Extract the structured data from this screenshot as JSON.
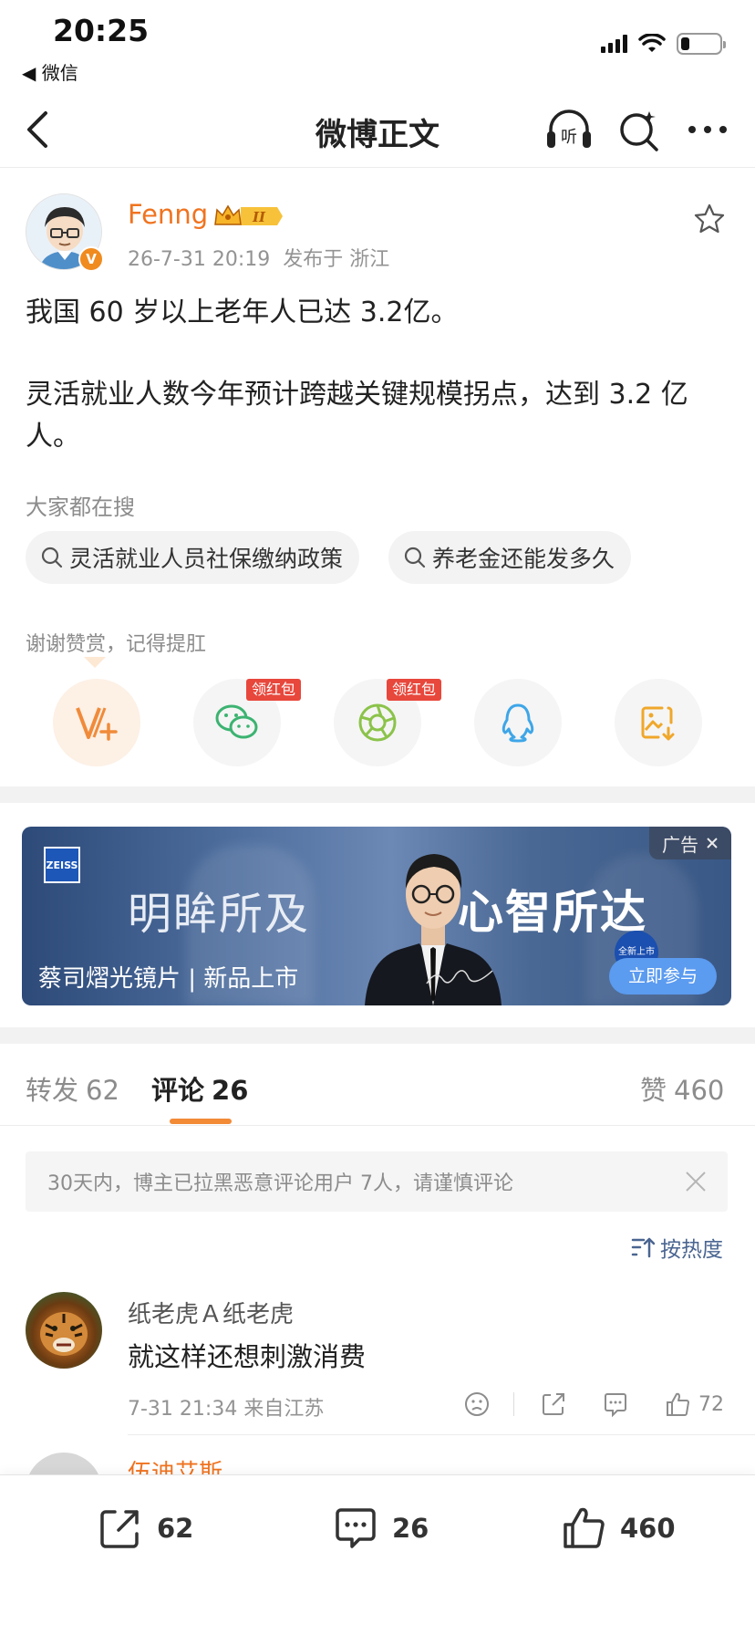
{
  "status_bar": {
    "time": "20:25",
    "back_app": "◀ 微信"
  },
  "nav": {
    "title": "微博正文",
    "listen_label": "听"
  },
  "post": {
    "author": "Fenng",
    "level_badge": "II",
    "date": "26-7-31 20:19",
    "location": "发布于 浙江",
    "paragraphs": [
      "我国 60 岁以上老年人已达 3.2亿。",
      "灵活就业人数今年预计跨越关键规模拐点，达到 3.2 亿人。"
    ]
  },
  "search_section": {
    "title": "大家都在搜",
    "chips": [
      "灵活就业人员社保缴纳政策",
      "养老金还能发多久"
    ]
  },
  "reward": {
    "thanks": "谢谢赞赏，记得提肛",
    "red_tag": "领红包"
  },
  "ad": {
    "brand_logo": "ZEISS",
    "headline_left": "明眸所及",
    "headline_right": "心智所达",
    "subtitle": "蔡司熠光镜片 | 新品上市",
    "ad_label": "广告",
    "cta": "立即参与",
    "bubble": "全新上市"
  },
  "tabs": {
    "repost_label": "转发",
    "repost_count": "62",
    "comment_label": "评论",
    "comment_count": "26",
    "like_label": "赞",
    "like_count": "460"
  },
  "notice": "30天内，博主已拉黑恶意评论用户 7人，请谨慎评论",
  "sort_label": "按热度",
  "comments": [
    {
      "user": "纸老虎Ａ纸老虎",
      "text": "就这样还想刺激消费",
      "meta": "7-31 21:34  来自江苏",
      "likes": "72"
    },
    {
      "user": "伍迪艾斯"
    }
  ],
  "bottom_bar": {
    "repost": "62",
    "comment": "26",
    "like": "460"
  },
  "colors": {
    "accent": "#f0731f",
    "tab_underline": "#f28a36",
    "link_blue": "#4a6591",
    "red_tag": "#e8473c"
  }
}
